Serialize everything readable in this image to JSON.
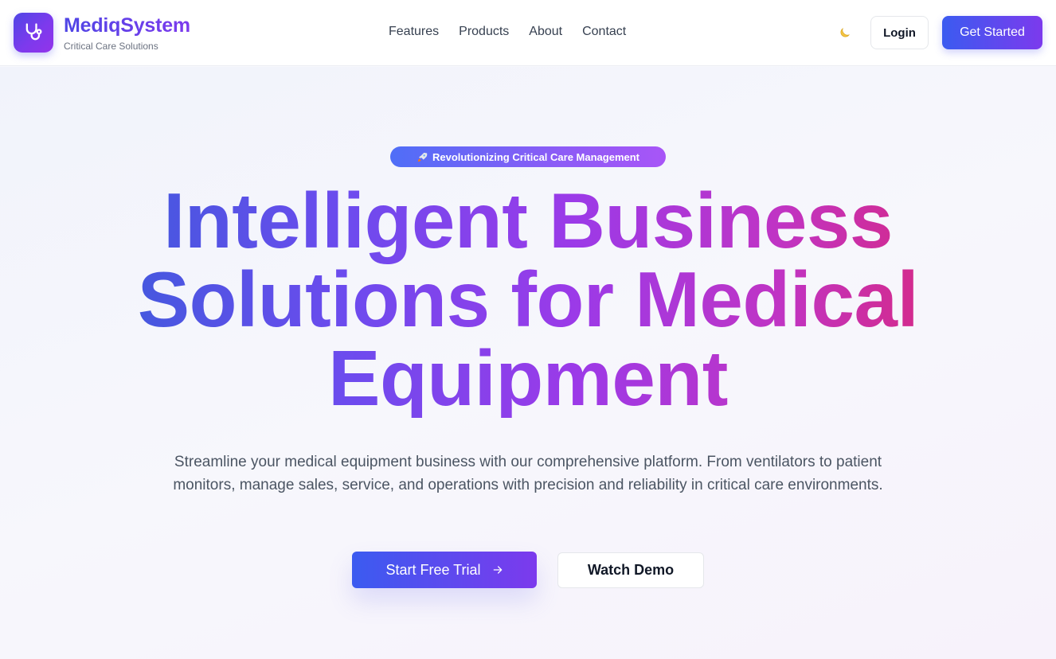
{
  "navbar": {
    "brand_name": "MediqSystem",
    "brand_tagline": "Critical Care Solutions",
    "logo_icon": "stethoscope-icon",
    "links": [
      {
        "label": "Features"
      },
      {
        "label": "Products"
      },
      {
        "label": "About"
      },
      {
        "label": "Contact"
      }
    ],
    "theme_toggle_icon": "moon-icon",
    "login_label": "Login",
    "get_started_label": "Get Started"
  },
  "hero": {
    "badge_icon": "rocket-icon",
    "badge_text": "Revolutionizing Critical Care Management",
    "headline_lines": [
      "Intelligent Business",
      "Solutions for Medical",
      "Equipment"
    ],
    "subtext": "Streamline your medical equipment business with our comprehensive platform. From ventilators to patient monitors, manage sales, service, and operations with precision and reliability in critical care environments.",
    "primary_cta": "Start Free Trial",
    "primary_cta_icon": "arrow-right-icon",
    "secondary_cta": "Watch Demo"
  },
  "colors": {
    "brand_primary": "#4f46e5",
    "brand_secondary": "#7c3aed",
    "headline_end": "#db2777",
    "background": "#f7f8fc"
  }
}
